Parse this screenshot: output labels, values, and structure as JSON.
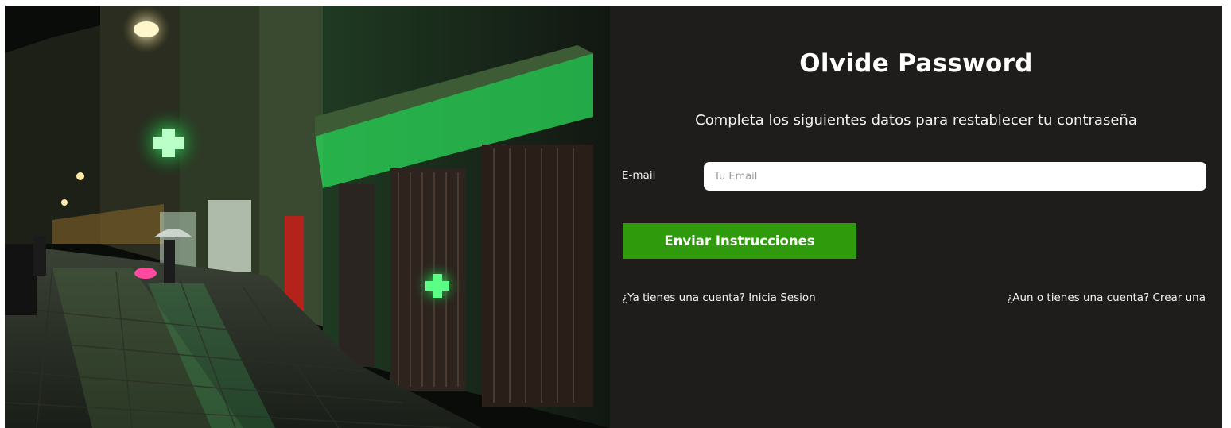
{
  "hero_image": {
    "description_icon": "night-street-photo"
  },
  "form": {
    "title": "Olvide Password",
    "subtitle": "Completa los siguientes datos para restablecer tu contraseña",
    "email_label": "E-mail",
    "email_value": "",
    "email_placeholder": "Tu Email",
    "submit_label": "Enviar Instrucciones"
  },
  "links": {
    "login": "¿Ya tienes una cuenta? Inicia Sesion",
    "register": "¿Aun o tienes una cuenta? Crear una"
  },
  "colors": {
    "panel_background": "#1f1d1b",
    "button": "#2f9a0b",
    "text": "#ffffff",
    "input_background": "#ffffff"
  }
}
